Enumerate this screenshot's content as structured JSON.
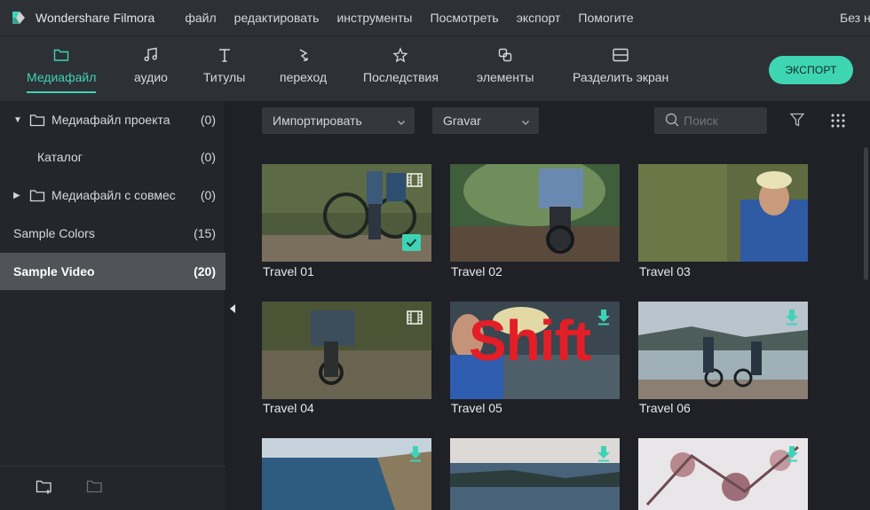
{
  "app": {
    "name": "Wondershare Filmora",
    "title_partial": "Без н"
  },
  "menu": [
    "файл",
    "редактировать",
    "инструменты",
    "Посмотреть",
    "экспорт",
    "Помогите"
  ],
  "toolbar": {
    "tools": [
      {
        "label": "Медиафайл",
        "icon": "folder-icon",
        "active": true
      },
      {
        "label": "аудио",
        "icon": "music-note-icon",
        "active": false
      },
      {
        "label": "Титулы",
        "icon": "text-icon",
        "active": false
      },
      {
        "label": "переход",
        "icon": "transition-icon",
        "active": false
      },
      {
        "label": "Последствия",
        "icon": "effects-star-icon",
        "active": false
      },
      {
        "label": "элементы",
        "icon": "elements-icon",
        "active": false
      },
      {
        "label": "Разделить экран",
        "icon": "split-screen-icon",
        "active": false
      }
    ],
    "export_label": "ЭКСПОРТ"
  },
  "sidebar": {
    "items": [
      {
        "label": "Медиафайл проекта",
        "count": "(0)",
        "arrow": "▼",
        "folder": true
      },
      {
        "label": "Каталог",
        "count": "(0)"
      },
      {
        "label": "Медиафайл с совмес",
        "count": "(0)",
        "arrow": "▶",
        "folder": true
      },
      {
        "label": "Sample Colors",
        "count": "(15)"
      },
      {
        "label": "Sample Video",
        "count": "(20)",
        "selected": true
      }
    ],
    "bottom_icons": [
      "new-folder-icon",
      "folder-disabled-icon"
    ]
  },
  "filterbar": {
    "import_label": "Импортировать",
    "sort_label": "Gravar",
    "search_placeholder": "Поиск"
  },
  "media": {
    "items": [
      {
        "label": "Travel 01",
        "selected": true,
        "badge": "film",
        "checked": true
      },
      {
        "label": "Travel 02",
        "selected": true
      },
      {
        "label": "Travel 03",
        "selected": true
      },
      {
        "label": "Travel 04",
        "selected": true,
        "badge": "film"
      },
      {
        "label": "Travel 05",
        "badge": "download"
      },
      {
        "label": "Travel 06",
        "badge": "download"
      },
      {
        "label": "",
        "badge": "download"
      },
      {
        "label": "",
        "badge": "download"
      },
      {
        "label": "",
        "badge": "download"
      }
    ]
  },
  "overlay_text": "Shift",
  "colors": {
    "accent": "#3fd3b6",
    "background": "#1f2127",
    "panel": "#24262c",
    "toolbar": "#2d3035",
    "overlay_red": "#e41e26"
  }
}
